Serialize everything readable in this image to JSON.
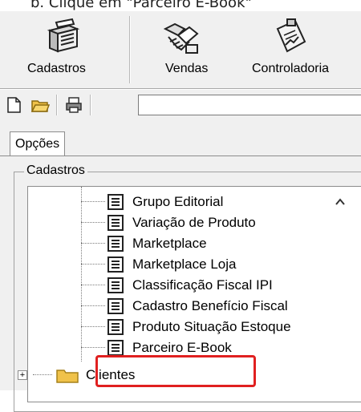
{
  "instruction": "b.   Clique em \"Parceiro E-Book\"",
  "toolbar": {
    "buttons": [
      {
        "label": "Cadastros",
        "icon": "folders-icon"
      },
      {
        "label": "Vendas",
        "icon": "handshake-icon"
      },
      {
        "label": "Controladoria",
        "icon": "report-icon"
      }
    ],
    "small_icons": [
      "new-document-icon",
      "open-folder-icon",
      "print-icon"
    ],
    "path_value": ""
  },
  "tabs": {
    "options": "Opções"
  },
  "group": {
    "title": "Cadastros"
  },
  "tree": {
    "items": [
      "Grupo Editorial",
      "Variação de Produto",
      "Marketplace",
      "Marketplace Loja",
      "Classificação Fiscal IPI",
      "Cadastro Benefício Fiscal",
      "Produto Situação Estoque",
      "Parceiro E-Book"
    ],
    "folder": "Clientes",
    "expander": "+"
  },
  "colors": {
    "highlight": "#e02020",
    "folder": "#f0c24a"
  }
}
